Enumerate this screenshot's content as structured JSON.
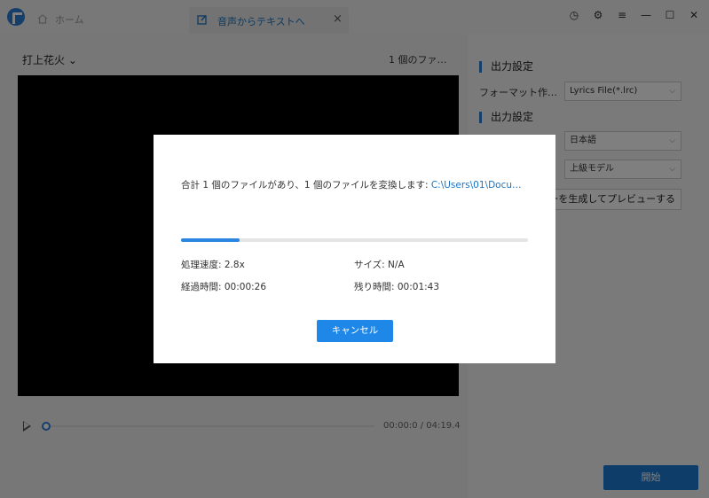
{
  "titlebar": {
    "home_tab": "ホーム",
    "active_tab": "音声からテキストへ",
    "close_tab": "×"
  },
  "player": {
    "video_title": "打上花火",
    "file_count": "1 個のファ…",
    "time": "00:00:0 / 04:19.4"
  },
  "settings": {
    "section1": "出力設定",
    "format_label": "フォーマット作…",
    "format_value": "Lyrics File(*.lrc)",
    "section2": "出力設定",
    "language_value": "日本語",
    "model_value": "上級モデル",
    "preview_button": "ーを生成してプレビューする",
    "start_button": "開始"
  },
  "dialog": {
    "message": "合計 1 個のファイルがあり、1 個のファイルを変換します: ",
    "path": "C:\\Users\\01\\Docu…",
    "progress": 0.17,
    "speed_label": "処理速度: 2.8x",
    "size_label": "サイズ: N/A",
    "elapsed_label": "経過時間: 00:00:26",
    "remaining_label": "残り時間: 00:01:43",
    "cancel": "キャンセル"
  },
  "colors": {
    "accent": "#1e7bd3"
  }
}
